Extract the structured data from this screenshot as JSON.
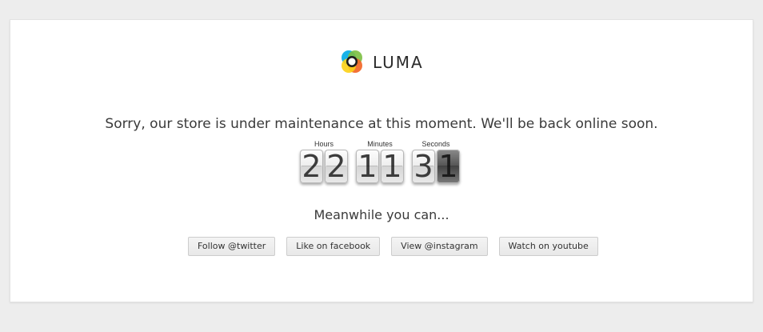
{
  "brand": {
    "name": "LUMA",
    "logo_colors": [
      "#f26322",
      "#0caee8",
      "#7bbf41",
      "#fcd116"
    ]
  },
  "message": "Sorry, our store is under maintenance at this moment. We'll be back online soon.",
  "countdown": {
    "hours": {
      "label": "Hours",
      "digits": [
        "2",
        "2"
      ]
    },
    "minutes": {
      "label": "Minutes",
      "digits": [
        "1",
        "1"
      ]
    },
    "seconds": {
      "label": "Seconds",
      "digits": [
        "3",
        "1"
      ]
    }
  },
  "meanwhile": "Meanwhile you can...",
  "social": {
    "twitter": "Follow @twitter",
    "facebook": "Like on facebook",
    "instagram": "View @instagram",
    "youtube": "Watch on youtube"
  }
}
